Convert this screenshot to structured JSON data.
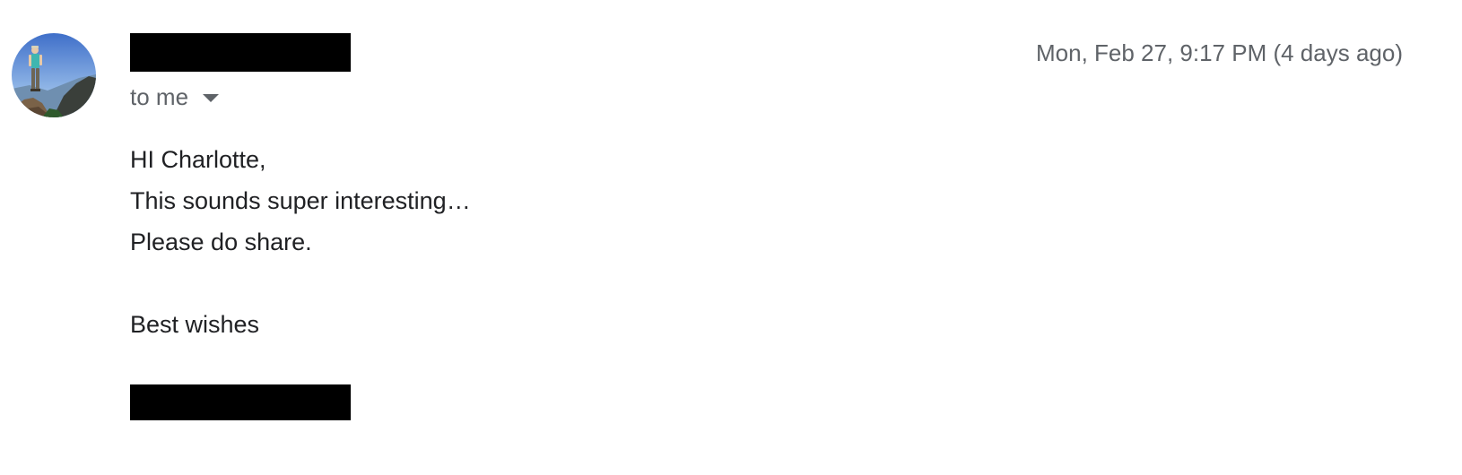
{
  "message": {
    "recipient_label": "to me",
    "timestamp": "Mon, Feb 27, 9:17 PM (4 days ago)",
    "body": {
      "greeting": "HI Charlotte,",
      "line1": "This sounds super interesting…",
      "line2": "Please do share.",
      "closing": "Best wishes"
    }
  },
  "icons": {
    "recipient_details": "chevron-down-icon",
    "sender_avatar": "avatar-photo-hiker-mountain"
  }
}
